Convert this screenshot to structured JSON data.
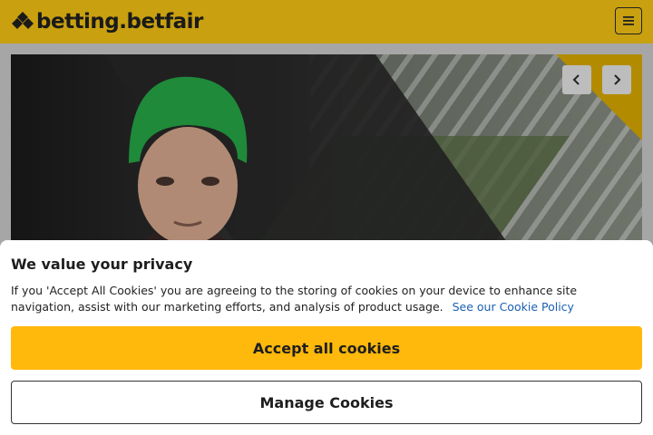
{
  "header": {
    "brand": "betting.betfair",
    "menu_icon": "hamburger-icon"
  },
  "carousel": {
    "prev_icon": "chevron-left-icon",
    "next_icon": "chevron-right-icon"
  },
  "cookie_banner": {
    "title": "We value your privacy",
    "description": "If you 'Accept All Cookies' you are agreeing to the storing of cookies on your device to enhance site navigation, assist with our marketing efforts, and analysis of product usage.",
    "policy_link": "See our Cookie Policy",
    "accept_label": "Accept all cookies",
    "manage_label": "Manage Cookies"
  },
  "colors": {
    "brand_yellow": "#ffb80c",
    "link_blue": "#1a5fb4"
  }
}
